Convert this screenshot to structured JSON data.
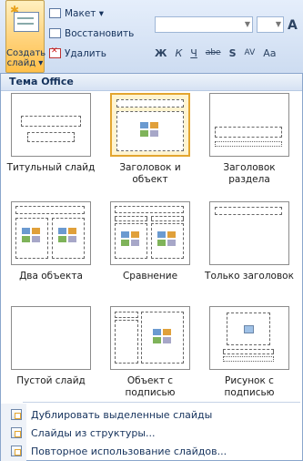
{
  "ribbon": {
    "create_slide_label_line1": "Создать",
    "create_slide_label_line2": "слайд ▾",
    "layout_button": "Макет ▾",
    "reset_button": "Восстановить",
    "delete_button": "Удалить",
    "format_buttons": [
      "Ж",
      "К",
      "Ч",
      "abe",
      "S",
      "AV",
      "Аа"
    ],
    "grow_font": "A"
  },
  "gallery": {
    "header": "Тема Office",
    "layouts": [
      {
        "name": "Титульный слайд",
        "caption": "Титульный слайд",
        "selected": false
      },
      {
        "name": "Заголовок и объект",
        "caption": "Заголовок и объект",
        "selected": true
      },
      {
        "name": "Заголовок раздела",
        "caption": "Заголовок раздела",
        "selected": false
      },
      {
        "name": "Два объекта",
        "caption": "Два объекта",
        "selected": false
      },
      {
        "name": "Сравнение",
        "caption": "Сравнение",
        "selected": false
      },
      {
        "name": "Только заголовок",
        "caption": "Только заголовок",
        "selected": false
      },
      {
        "name": "Пустой слайд",
        "caption": "Пустой слайд",
        "selected": false
      },
      {
        "name": "Объект с подписью",
        "caption": "Объект с подписью",
        "selected": false
      },
      {
        "name": "Рисунок с подписью",
        "caption": "Рисунок с подписью",
        "selected": false
      }
    ]
  },
  "commands": [
    {
      "label": "Дублировать выделенные слайды"
    },
    {
      "label": "Слайды из структуры..."
    },
    {
      "label": "Повторное использование слайдов..."
    }
  ],
  "colors": {
    "accent": "#e3a52f",
    "text": "#15325c",
    "ribbon_bg": "#dbe6f4"
  }
}
